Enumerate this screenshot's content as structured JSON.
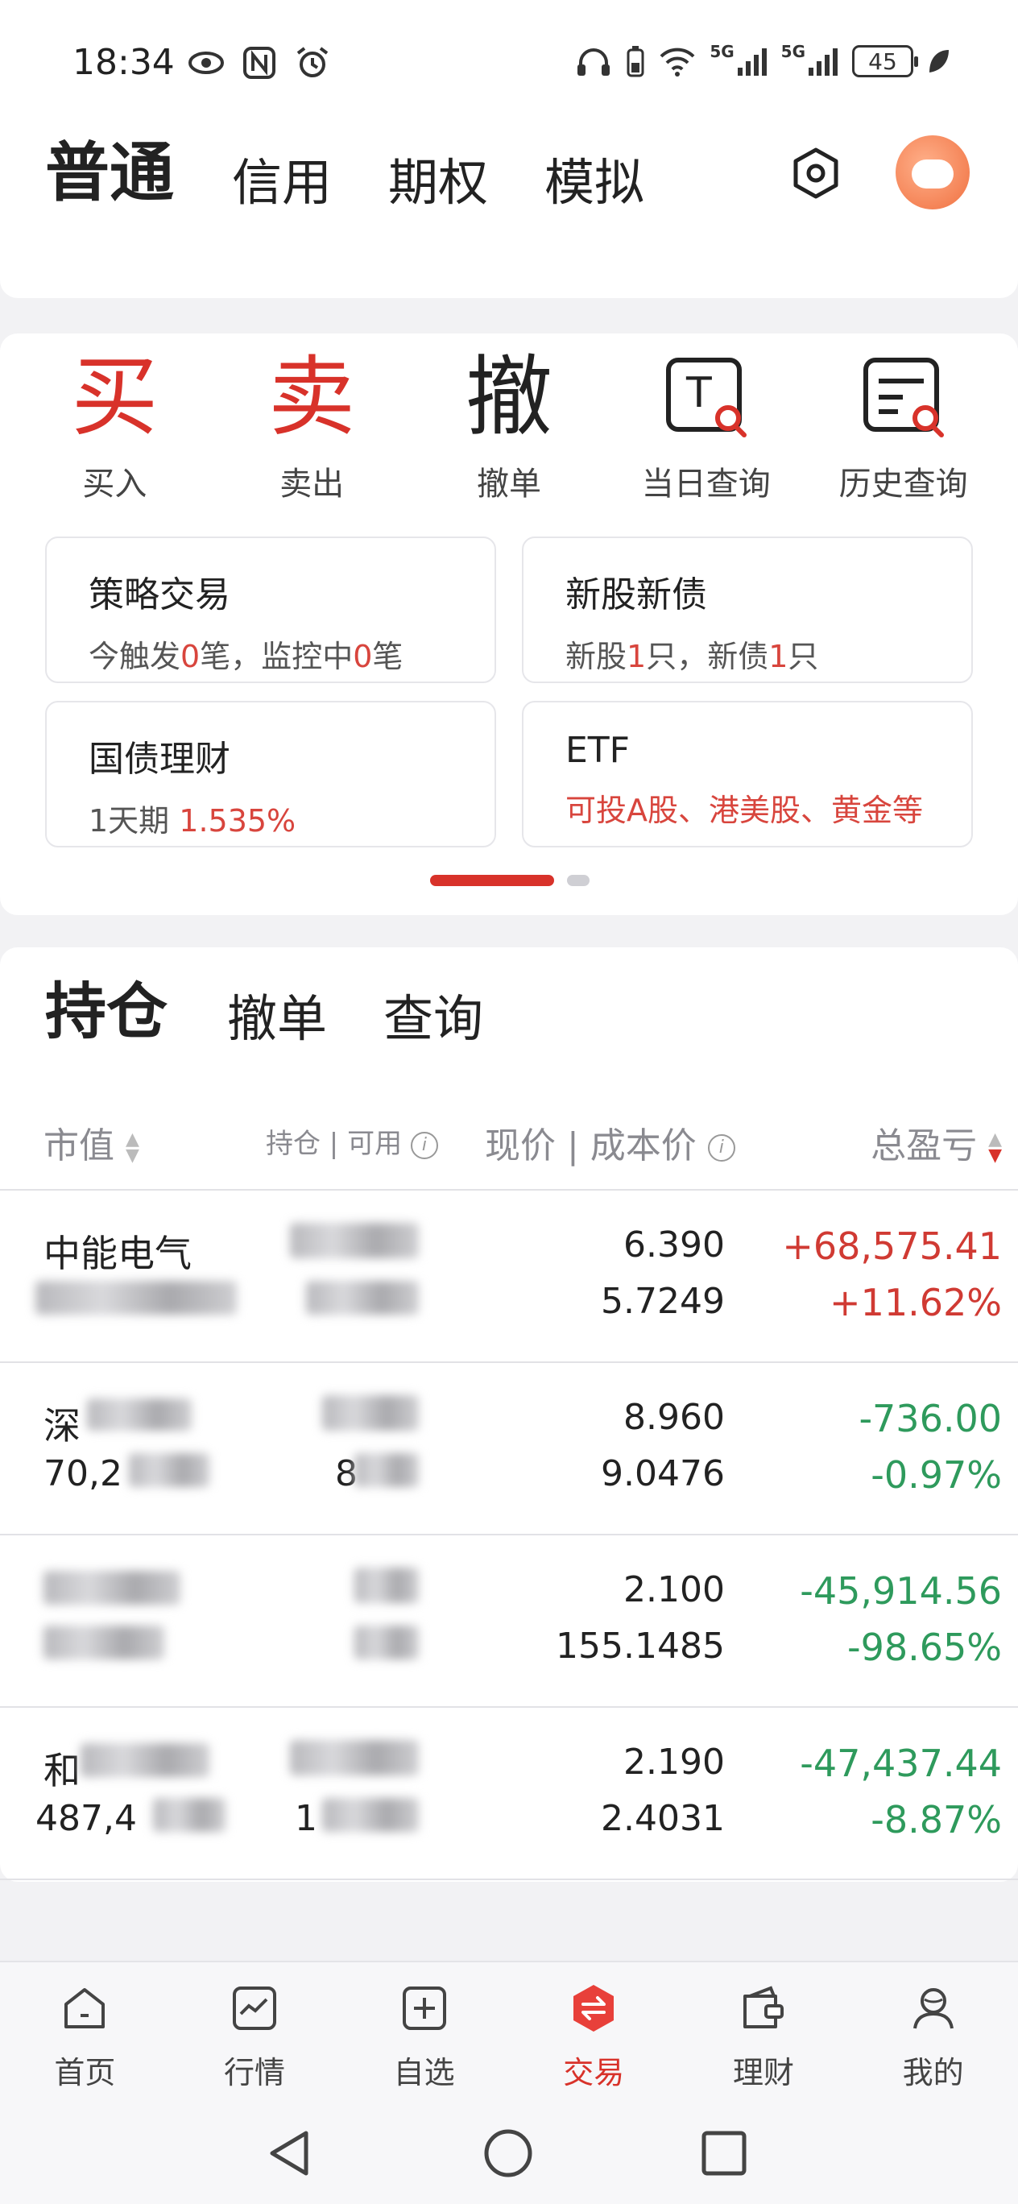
{
  "status_bar": {
    "time": "18:34",
    "left_icons": [
      "eye-icon",
      "nfc-icon",
      "alarm-icon"
    ],
    "right_icons": [
      "headphones-icon",
      "battery-saver-icon",
      "wifi-icon",
      "signal-5g-icon",
      "signal-5g-icon",
      "leaf-icon"
    ],
    "net1": "5G",
    "net2": "5G",
    "battery": "45"
  },
  "header": {
    "tabs": [
      "普通",
      "信用",
      "期权",
      "模拟"
    ],
    "active_tab": "普通",
    "settings_icon": "hexagon-settings-icon",
    "avatar_icon": "avatar"
  },
  "actions": [
    {
      "glyph": "买",
      "label": "买入",
      "icon": "buy-icon"
    },
    {
      "glyph": "卖",
      "label": "卖出",
      "icon": "sell-icon"
    },
    {
      "glyph": "撤",
      "label": "撤单",
      "icon": "cancel-order-icon"
    },
    {
      "glyph": "T",
      "label": "当日查询",
      "icon": "today-query-icon"
    },
    {
      "glyph": "≡",
      "label": "历史查询",
      "icon": "history-query-icon"
    }
  ],
  "features": [
    {
      "title": "策略交易",
      "sub_parts": [
        "今触发",
        "0",
        "笔，监控中",
        "0",
        "笔"
      ]
    },
    {
      "title": "新股新债",
      "sub_parts": [
        "新股",
        "1",
        "只，新债",
        "1",
        "只"
      ]
    },
    {
      "title": "国债理财",
      "sub_parts": [
        "1天期 ",
        "1.535%"
      ]
    },
    {
      "title": "ETF",
      "sub_red": "可投A股、港美股、黄金等"
    }
  ],
  "holdings": {
    "tabs": [
      "持仓",
      "撤单",
      "查询"
    ],
    "active_tab": "持仓",
    "columns": {
      "market_value": "市值",
      "position": "持仓",
      "available": "可用",
      "price": "现价",
      "cost": "成本价",
      "pl": "总盈亏"
    },
    "rows": [
      {
        "name": "中能电气",
        "market_value": "",
        "price": "6.390",
        "cost": "5.7249",
        "pl": "+68,575.41",
        "pl_pct": "+11.62%",
        "trend": "up"
      },
      {
        "name": "深",
        "market_value": "70,2",
        "position_partial": "8",
        "price": "8.960",
        "cost": "9.0476",
        "pl": "-736.00",
        "pl_pct": "-0.97%",
        "trend": "down"
      },
      {
        "name": "",
        "market_value": "",
        "price": "2.100",
        "cost": "155.1485",
        "pl": "-45,914.56",
        "pl_pct": "-98.65%",
        "trend": "down"
      },
      {
        "name": "和",
        "market_value": "487,4",
        "position_partial": "1",
        "price": "2.190",
        "cost": "2.4031",
        "pl": "-47,437.44",
        "pl_pct": "-8.87%",
        "trend": "down"
      }
    ]
  },
  "bottom_nav": [
    {
      "label": "首页",
      "icon": "home-icon"
    },
    {
      "label": "行情",
      "icon": "market-chart-icon"
    },
    {
      "label": "自选",
      "icon": "add-watchlist-icon"
    },
    {
      "label": "交易",
      "icon": "trade-exchange-icon",
      "active": true
    },
    {
      "label": "理财",
      "icon": "wallet-icon"
    },
    {
      "label": "我的",
      "icon": "profile-icon"
    }
  ],
  "colors": {
    "accent_red": "#d8322a",
    "profit_red": "#d03a33",
    "loss_green": "#2e9a5c"
  }
}
